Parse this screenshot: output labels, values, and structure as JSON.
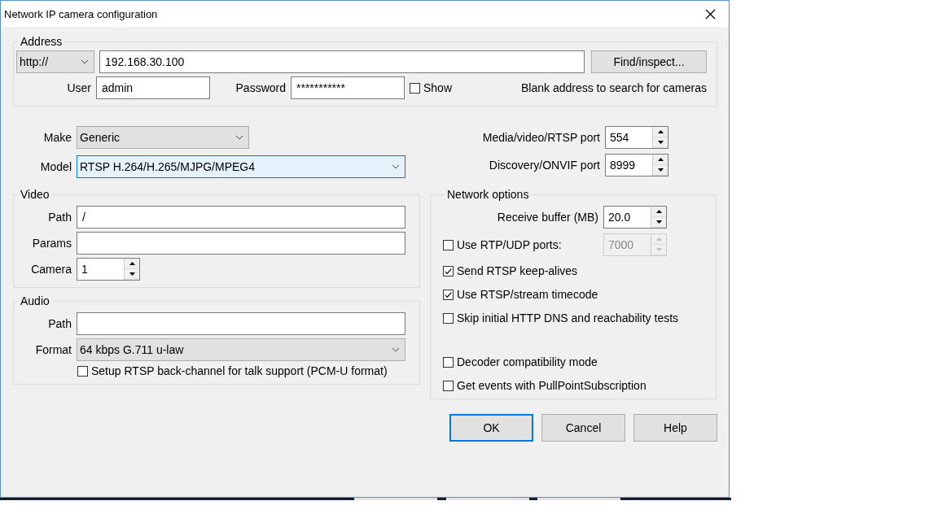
{
  "window": {
    "title": "Network IP camera configuration"
  },
  "address": {
    "legend": "Address",
    "scheme": "http://",
    "host": "192.168.30.100",
    "find_button": "Find/inspect...",
    "user_label": "User",
    "user": "admin",
    "password_label": "Password",
    "password": "***********",
    "show": {
      "label": "Show",
      "checked": false
    },
    "hint": "Blank address to search for cameras"
  },
  "make": {
    "label": "Make",
    "value": "Generic",
    "focused": false
  },
  "model": {
    "label": "Model",
    "value": "RTSP H.264/H.265/MJPG/MPEG4",
    "focused": true
  },
  "ports": [
    {
      "label": "Media/video/RTSP port",
      "value": "554"
    },
    {
      "label": "Discovery/ONVIF port",
      "value": "8999"
    }
  ],
  "video": {
    "legend": "Video",
    "path_label": "Path",
    "path": "/",
    "params_label": "Params",
    "camera_label": "Camera",
    "camera": "1"
  },
  "audio": {
    "legend": "Audio",
    "path_label": "Path",
    "format_label": "Format",
    "format": "64 kbps G.711 u-law",
    "backchannel": {
      "label": "Setup RTSP back-channel for talk support (PCM-U format)",
      "checked": false
    }
  },
  "network": {
    "legend": "Network options",
    "buffer_label": "Receive buffer (MB)",
    "buffer": "20.0",
    "rtp": {
      "label": "Use RTP/UDP ports:",
      "checked": false,
      "port": "7000",
      "disabled": true
    },
    "options": [
      {
        "label": "Send RTSP keep-alives",
        "checked": true
      },
      {
        "label": "Use RTSP/stream timecode",
        "checked": true
      },
      {
        "label": "Skip initial HTTP DNS and reachability tests",
        "checked": false
      }
    ],
    "more_options": [
      {
        "label": "Decoder compatibility mode",
        "checked": false
      },
      {
        "label": "Get events with PullPointSubscription",
        "checked": false
      }
    ]
  },
  "buttons": [
    {
      "label": "OK",
      "default": true
    },
    {
      "label": "Cancel",
      "default": false
    },
    {
      "label": "Help",
      "default": false
    }
  ]
}
